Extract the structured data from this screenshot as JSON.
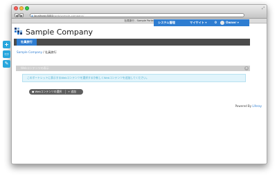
{
  "window": {
    "title": "社員旅行 - Sample Portal",
    "tab_title": "社員旅行 - Sample Portal"
  },
  "browser": {
    "back_label": "◀",
    "forward_label": "▶",
    "url_host": "localhost:8080",
    "url_path": "/web/sample-company/"
  },
  "dockbar": {
    "items": [
      "システム管理",
      "マイサイト ▾",
      "0"
    ],
    "user": "Owner ▾"
  },
  "sidebar": {
    "items": [
      {
        "label": "+",
        "icon": "add-icon"
      },
      {
        "label": "▭",
        "icon": "display-icon"
      },
      {
        "label": "✎",
        "icon": "edit-icon"
      }
    ]
  },
  "site": {
    "company": "Sample Company",
    "nav_tab": "社員旅行",
    "breadcrumb_home": "Sample Company",
    "breadcrumb_sep": " / ",
    "breadcrumb_current": "社員旅行"
  },
  "portlet": {
    "title": "Webコンテンツの表示",
    "info": "このポートレットに表示するWebコンテンツを選択するか新しくWebコンテンツを追加してください。",
    "select_label": "● Webコンテンツの選択",
    "add_label": "+ 追加"
  },
  "footer": {
    "powered_prefix": "Powered By ",
    "powered_brand": "Liferay"
  },
  "colors": {
    "accent": "#2e7dd1",
    "side_buttons": "#28a6dc",
    "navbar": "#4b4b4b",
    "info_bg": "#e1f4fb"
  }
}
